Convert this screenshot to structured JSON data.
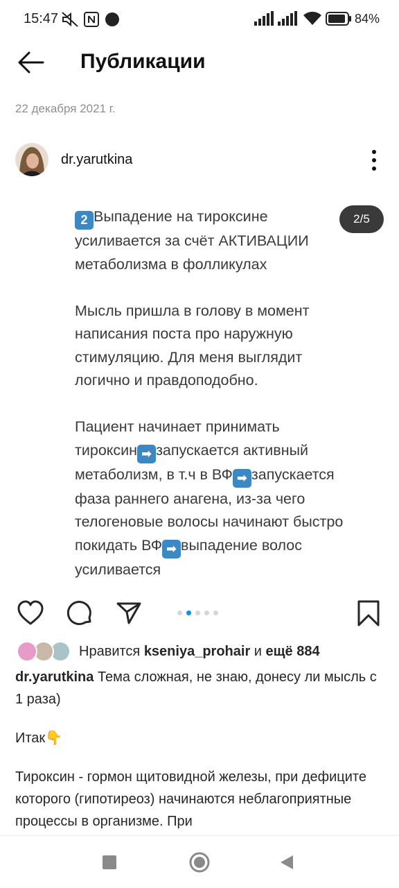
{
  "status_bar": {
    "time": "15:47",
    "battery": "84%",
    "icons": [
      "mute-icon",
      "nfc-icon",
      "dot-icon",
      "signal-icon",
      "signal-icon",
      "wifi-icon",
      "battery-icon"
    ]
  },
  "app_bar": {
    "title": "Публикации",
    "back_icon": "arrow-left-icon"
  },
  "post": {
    "date": "22 декабря 2021 г.",
    "username": "dr.yarutkina",
    "slide_counter": "2/5",
    "slide": {
      "p1_number": "2",
      "p1": "Выпадение на тироксине\nусиливается за счёт АКТИВАЦИИ\nметаболизма в фолликулах",
      "p2": "Мысль пришла в голову в момент\nнаписания поста про наружную\nстимуляцию. Для меня выглядит\nлогично и правдоподобно.",
      "p3_a": "Пациент начинает принимать\nтироксин",
      "p3_b": "запускается активный\nметаболизм, в т.ч в ВФ",
      "p3_c": "запускается\nфаза раннего анагена, из-за чего\nтелогеновые волосы начинают быстро\nпокидать ВФ",
      "p3_d": "выпадение волос\nусиливается",
      "arrow_emoji": "➡"
    },
    "carousel": {
      "count": 5,
      "active": 2
    },
    "likes": {
      "prefix": "Нравится ",
      "user": "kseniya_prohair",
      "middle": " и ",
      "more": "ещё 884"
    },
    "caption": {
      "username": "dr.yarutkina",
      "text": " Тема сложная, не знаю, донесу ли мысль с 1 раза)",
      "line2": "Итак",
      "line2_emoji": "👇",
      "line3": "Тироксин - гормон щитовидной железы, при дефиците которого (гипотиреоз) начинаются неблагоприятные процессы в организме. При"
    }
  },
  "colors": {
    "accent_blue": "#0095f6",
    "counter_bg": "#3a3a3a",
    "text": "#262626",
    "muted": "#8e8e8e"
  }
}
